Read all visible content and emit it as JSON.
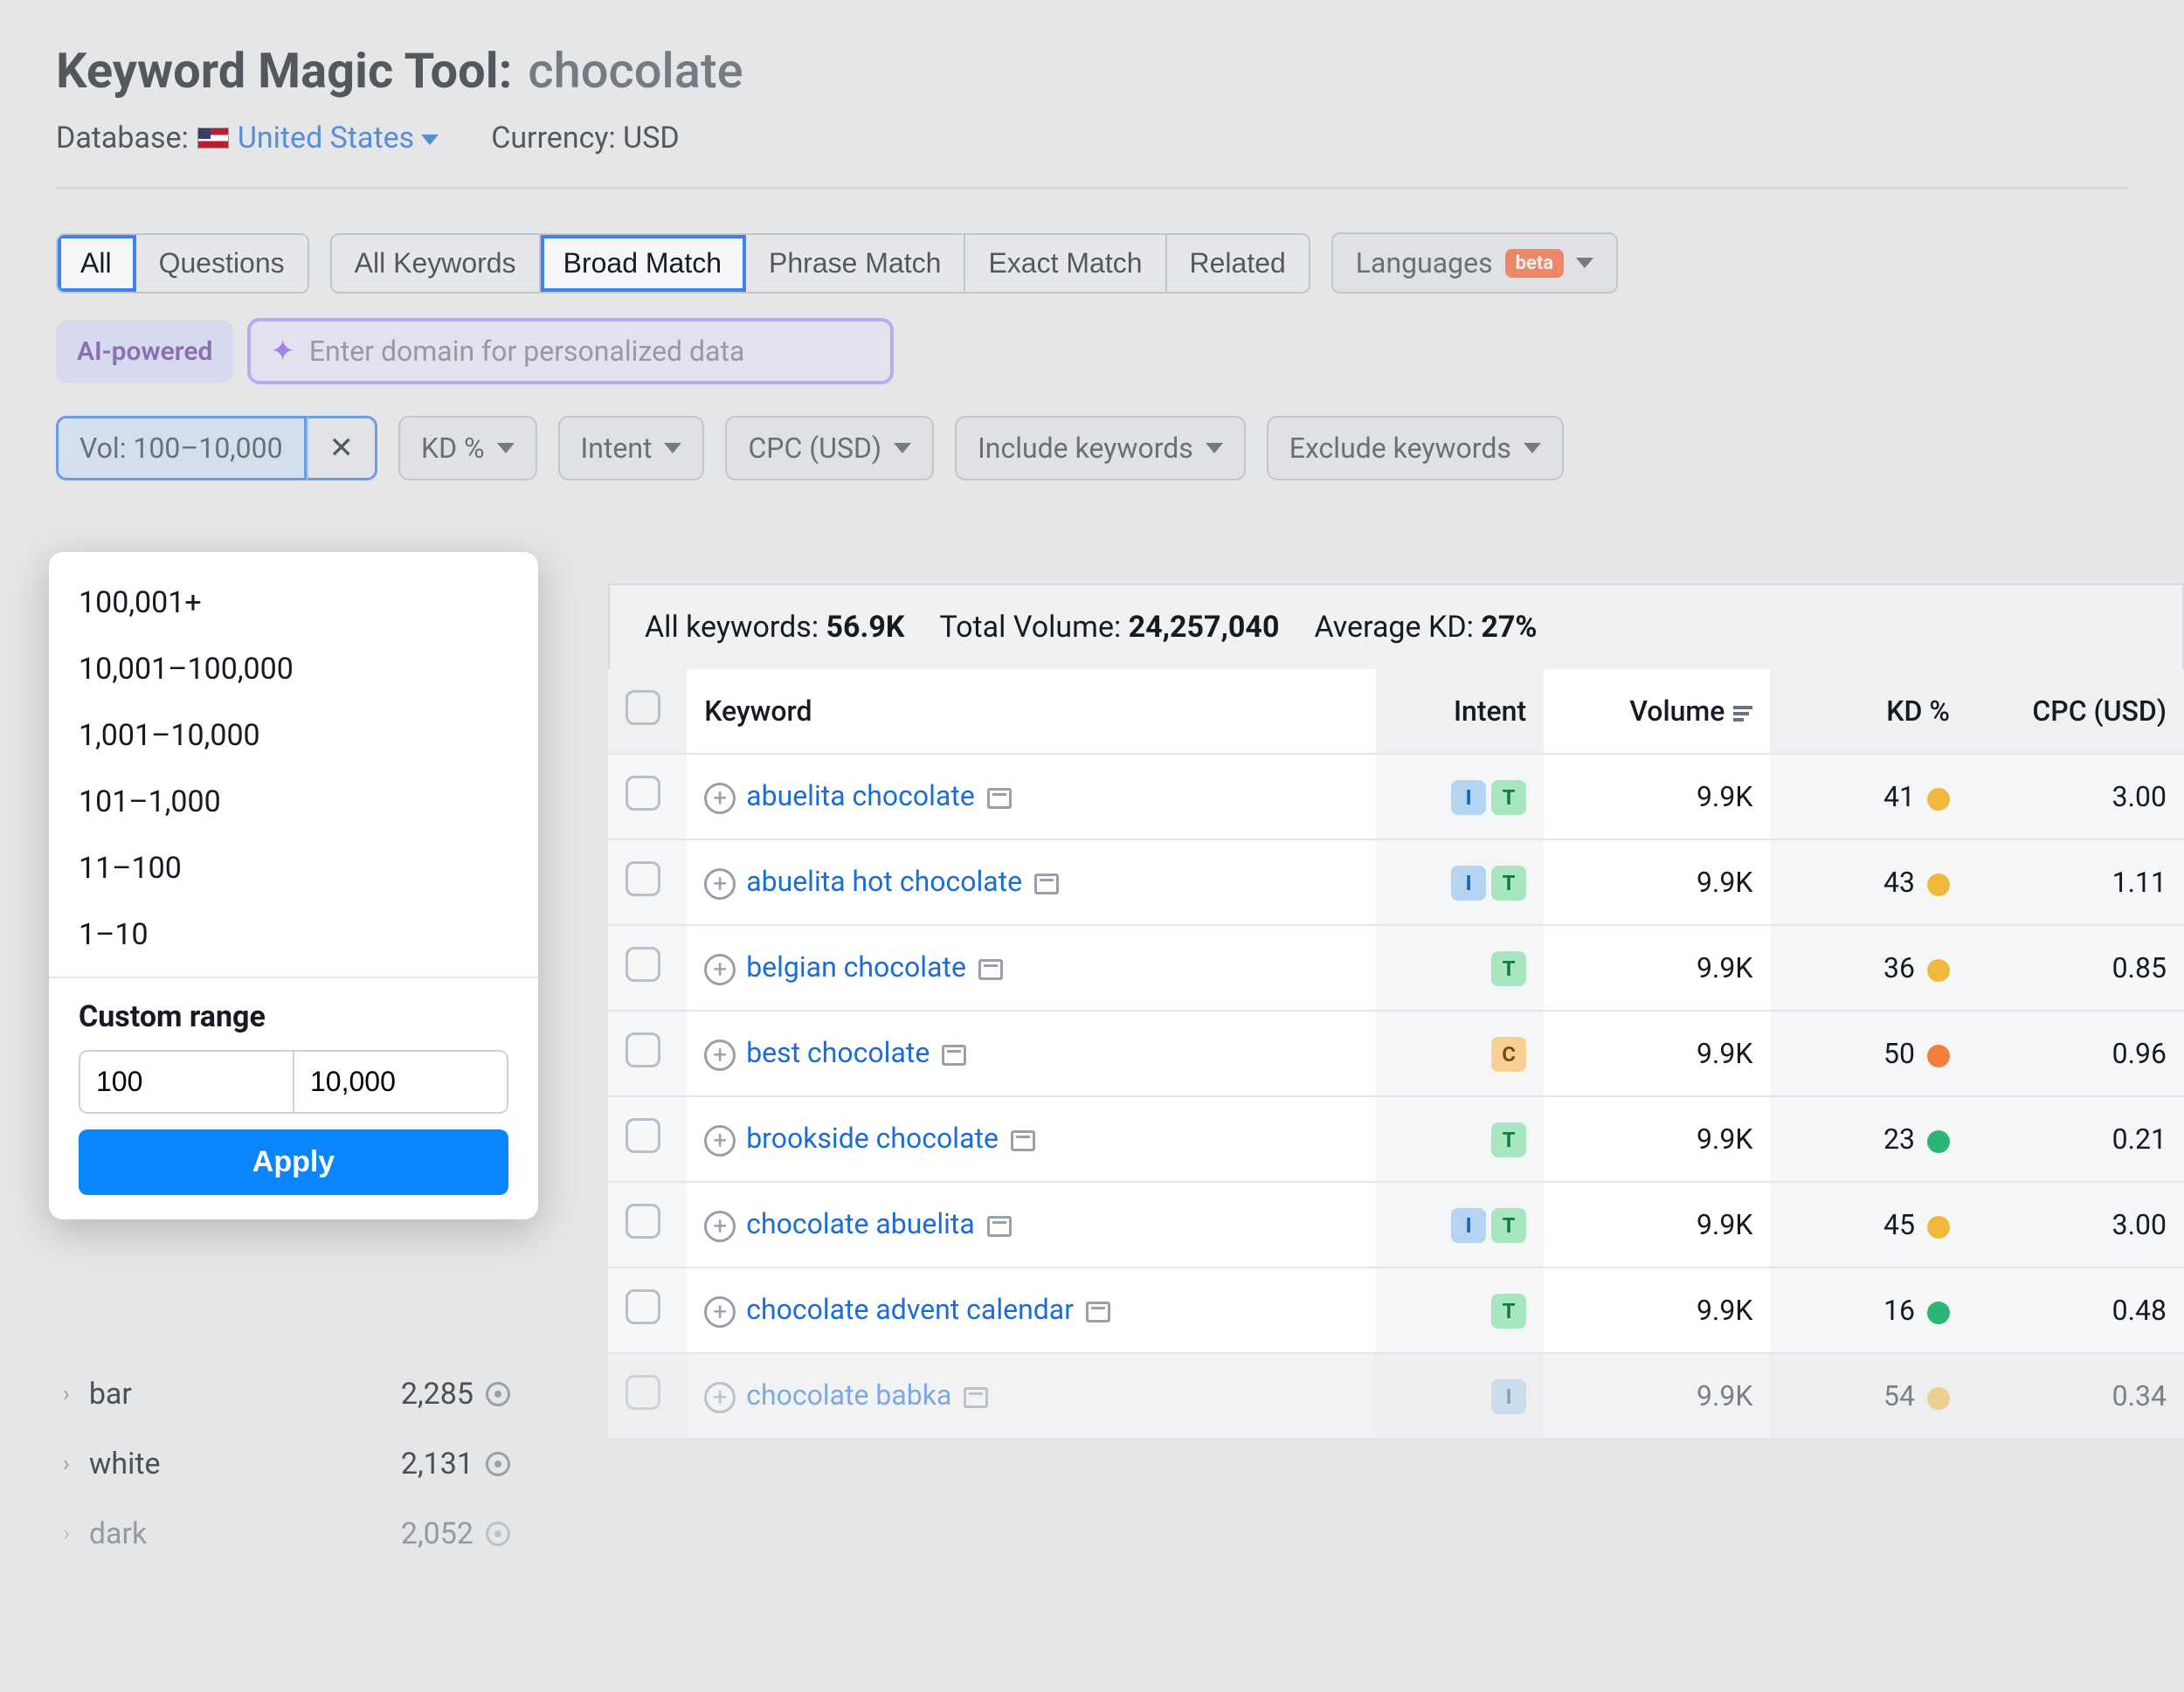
{
  "header": {
    "title_label": "Keyword Magic Tool:",
    "title_value": "chocolate",
    "db_label": "Database:",
    "db_value": "United States",
    "currency_label": "Currency: USD"
  },
  "tabs1": {
    "all": "All",
    "questions": "Questions"
  },
  "tabs2": {
    "all_kw": "All Keywords",
    "broad": "Broad Match",
    "phrase": "Phrase Match",
    "exact": "Exact Match",
    "related": "Related"
  },
  "languages": {
    "label": "Languages",
    "badge": "beta"
  },
  "ai": {
    "chip": "AI-powered",
    "placeholder": "Enter domain for personalized data"
  },
  "filters": {
    "vol": "Vol: 100–10,000",
    "kd": "KD %",
    "intent": "Intent",
    "cpc": "CPC (USD)",
    "include": "Include keywords",
    "exclude": "Exclude keywords"
  },
  "dropdown": {
    "items": [
      "100,001+",
      "10,001–100,000",
      "1,001–10,000",
      "101–1,000",
      "11–100",
      "1–10"
    ],
    "custom_label": "Custom range",
    "from": "100",
    "to": "10,000",
    "apply": "Apply"
  },
  "sidebar": [
    {
      "label": "bar",
      "count": "2,285"
    },
    {
      "label": "white",
      "count": "2,131"
    },
    {
      "label": "dark",
      "count": "2,052"
    }
  ],
  "summary": {
    "all_kw_label": "All keywords:",
    "all_kw": "56.9K",
    "tot_vol_label": "Total Volume:",
    "tot_vol": "24,257,040",
    "avg_kd_label": "Average KD:",
    "avg_kd": "27%"
  },
  "columns": {
    "keyword": "Keyword",
    "intent": "Intent",
    "volume": "Volume",
    "kd": "KD %",
    "cpc": "CPC (USD)"
  },
  "rows": [
    {
      "kw": "abuelita chocolate",
      "intents": [
        "I",
        "T"
      ],
      "vol": "9.9K",
      "kd": "41",
      "kd_dot": "dot-y",
      "cpc": "3.00"
    },
    {
      "kw": "abuelita hot chocolate",
      "intents": [
        "I",
        "T"
      ],
      "vol": "9.9K",
      "kd": "43",
      "kd_dot": "dot-y",
      "cpc": "1.11"
    },
    {
      "kw": "belgian chocolate",
      "intents": [
        "T"
      ],
      "vol": "9.9K",
      "kd": "36",
      "kd_dot": "dot-y",
      "cpc": "0.85"
    },
    {
      "kw": "best chocolate",
      "intents": [
        "C"
      ],
      "vol": "9.9K",
      "kd": "50",
      "kd_dot": "dot-o",
      "cpc": "0.96"
    },
    {
      "kw": "brookside chocolate",
      "intents": [
        "T"
      ],
      "vol": "9.9K",
      "kd": "23",
      "kd_dot": "dot-g",
      "cpc": "0.21"
    },
    {
      "kw": "chocolate abuelita",
      "intents": [
        "I",
        "T"
      ],
      "vol": "9.9K",
      "kd": "45",
      "kd_dot": "dot-y",
      "cpc": "3.00"
    },
    {
      "kw": "chocolate advent calendar",
      "intents": [
        "T"
      ],
      "vol": "9.9K",
      "kd": "16",
      "kd_dot": "dot-g",
      "cpc": "0.48"
    },
    {
      "kw": "chocolate babka",
      "intents": [
        "I"
      ],
      "vol": "9.9K",
      "kd": "54",
      "kd_dot": "dot-y",
      "cpc": "0.34"
    }
  ]
}
